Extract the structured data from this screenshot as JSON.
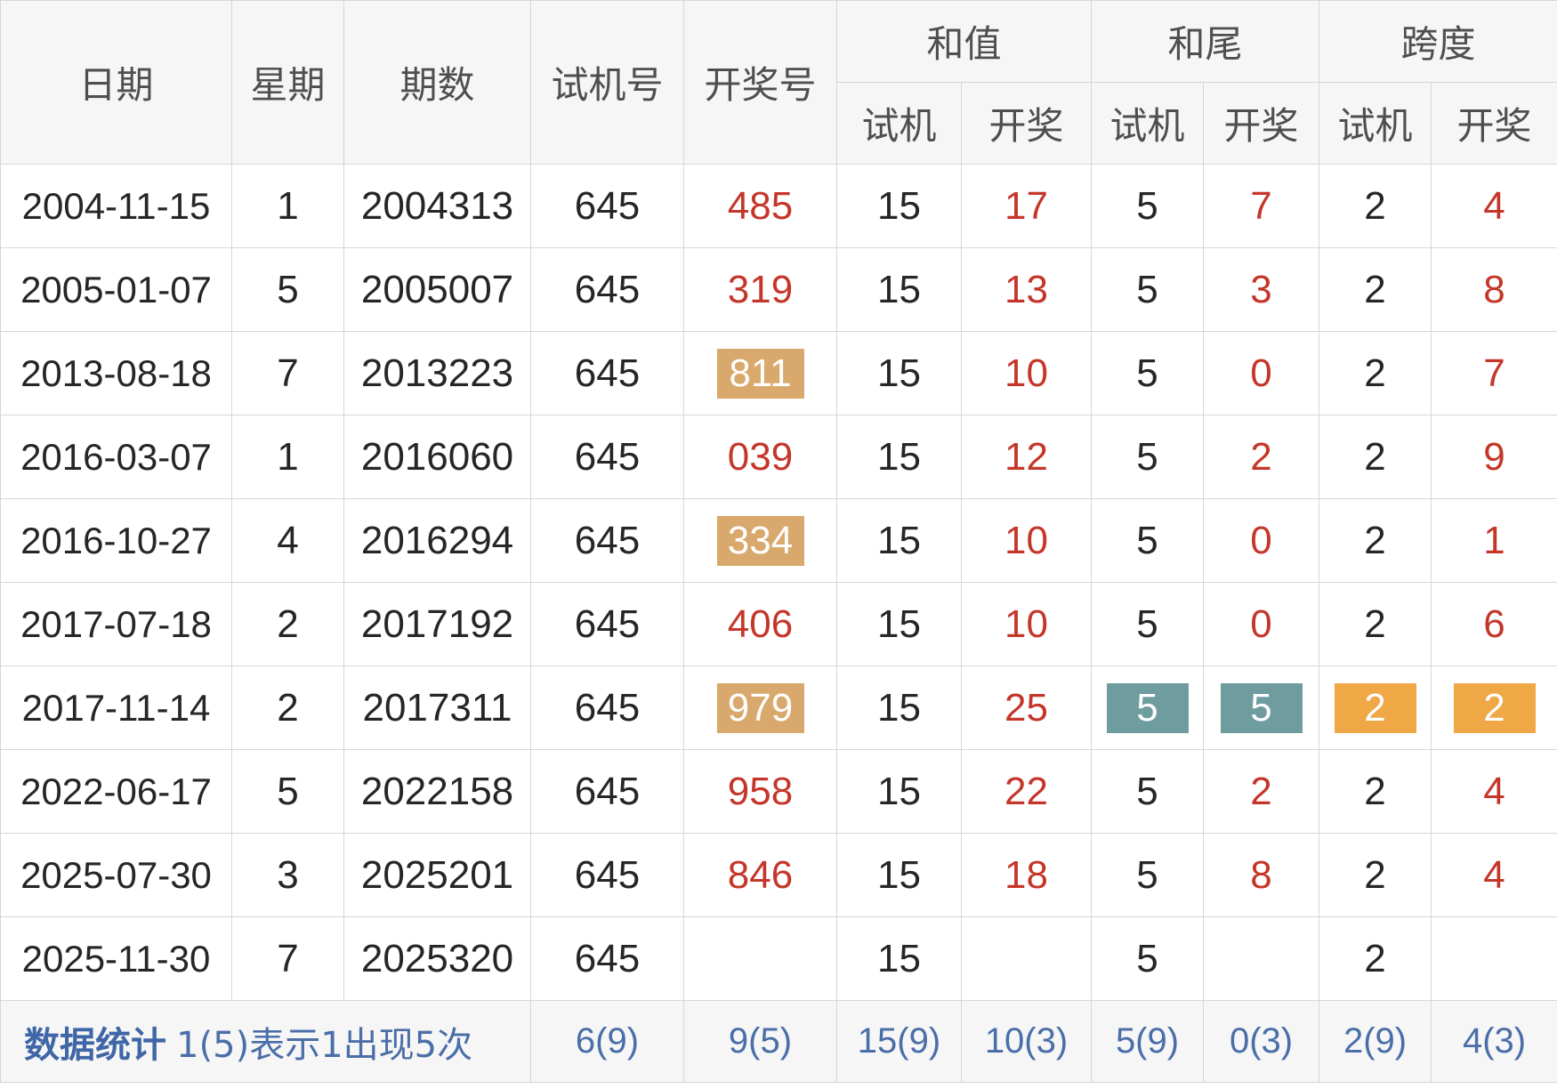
{
  "header": {
    "date": "日期",
    "weekday": "星期",
    "issue": "期数",
    "trial": "试机号",
    "draw": "开奖号",
    "sum": "和值",
    "tail": "和尾",
    "span": "跨度",
    "sub_trial": "试机",
    "sub_draw": "开奖"
  },
  "rows": [
    {
      "date": "2004-11-15",
      "weekday": "1",
      "issue": "2004313",
      "trial": "645",
      "draw": "485",
      "sum_trial": "15",
      "sum_draw": "17",
      "tail_trial": "5",
      "tail_draw": "7",
      "span_trial": "2",
      "span_draw": "4"
    },
    {
      "date": "2005-01-07",
      "weekday": "5",
      "issue": "2005007",
      "trial": "645",
      "draw": "319",
      "sum_trial": "15",
      "sum_draw": "13",
      "tail_trial": "5",
      "tail_draw": "3",
      "span_trial": "2",
      "span_draw": "8"
    },
    {
      "date": "2013-08-18",
      "weekday": "7",
      "issue": "2013223",
      "trial": "645",
      "draw": "811",
      "sum_trial": "15",
      "sum_draw": "10",
      "tail_trial": "5",
      "tail_draw": "0",
      "span_trial": "2",
      "span_draw": "7"
    },
    {
      "date": "2016-03-07",
      "weekday": "1",
      "issue": "2016060",
      "trial": "645",
      "draw": "039",
      "sum_trial": "15",
      "sum_draw": "12",
      "tail_trial": "5",
      "tail_draw": "2",
      "span_trial": "2",
      "span_draw": "9"
    },
    {
      "date": "2016-10-27",
      "weekday": "4",
      "issue": "2016294",
      "trial": "645",
      "draw": "334",
      "sum_trial": "15",
      "sum_draw": "10",
      "tail_trial": "5",
      "tail_draw": "0",
      "span_trial": "2",
      "span_draw": "1"
    },
    {
      "date": "2017-07-18",
      "weekday": "2",
      "issue": "2017192",
      "trial": "645",
      "draw": "406",
      "sum_trial": "15",
      "sum_draw": "10",
      "tail_trial": "5",
      "tail_draw": "0",
      "span_trial": "2",
      "span_draw": "6"
    },
    {
      "date": "2017-11-14",
      "weekday": "2",
      "issue": "2017311",
      "trial": "645",
      "draw": "979",
      "sum_trial": "15",
      "sum_draw": "25",
      "tail_trial": "5",
      "tail_draw": "5",
      "span_trial": "2",
      "span_draw": "2"
    },
    {
      "date": "2022-06-17",
      "weekday": "5",
      "issue": "2022158",
      "trial": "645",
      "draw": "958",
      "sum_trial": "15",
      "sum_draw": "22",
      "tail_trial": "5",
      "tail_draw": "2",
      "span_trial": "2",
      "span_draw": "4"
    },
    {
      "date": "2025-07-30",
      "weekday": "3",
      "issue": "2025201",
      "trial": "645",
      "draw": "846",
      "sum_trial": "15",
      "sum_draw": "18",
      "tail_trial": "5",
      "tail_draw": "8",
      "span_trial": "2",
      "span_draw": "4"
    },
    {
      "date": "2025-11-30",
      "weekday": "7",
      "issue": "2025320",
      "trial": "645",
      "draw": "",
      "sum_trial": "15",
      "sum_draw": "",
      "tail_trial": "5",
      "tail_draw": "",
      "span_trial": "2",
      "span_draw": ""
    }
  ],
  "stats": {
    "title": "数据统计",
    "note": "1(5)表示1出现5次",
    "trial": "6(9)",
    "draw": "9(5)",
    "sum_trial": "15(9)",
    "sum_draw": "10(3)",
    "tail_trial": "5(9)",
    "tail_draw": "0(3)",
    "span_trial": "2(9)",
    "span_draw": "4(3)"
  },
  "colors": {
    "draw_text": "#c5362a",
    "highlight_draw": "#d9a86c",
    "highlight_tail": "#6e9c9f",
    "highlight_span": "#f0a846",
    "stats_text": "#4a6ea8"
  }
}
